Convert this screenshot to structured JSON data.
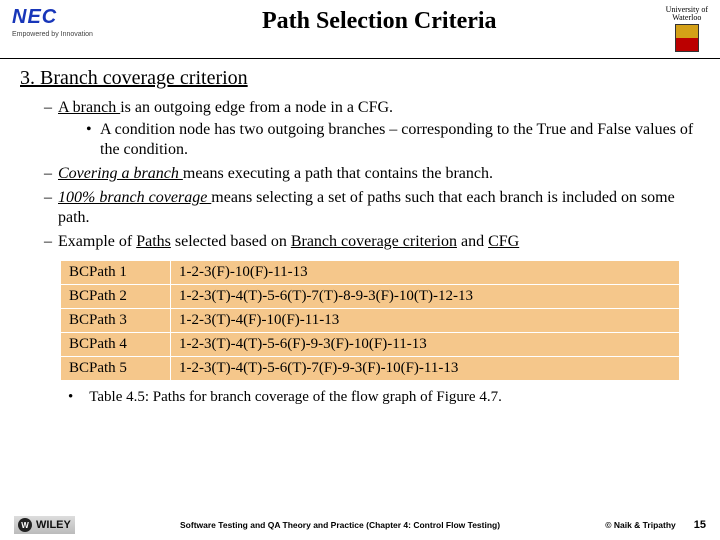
{
  "header": {
    "nec": "NEC",
    "nec_tag": "Empowered by Innovation",
    "title": "Path Selection Criteria",
    "uw_line1": "University of",
    "uw_line2": "Waterloo"
  },
  "section": {
    "heading": "3. Branch coverage criterion",
    "b1_pre": "A branch ",
    "b1_post": "is an outgoing edge from a node in a CFG.",
    "b1_sub": "A condition node has two outgoing branches – corresponding to the True and False values of the condition.",
    "b2_pre": "Covering a branch ",
    "b2_post": "means executing a path that contains the branch.",
    "b3_pre": "100% branch coverage ",
    "b3_post": "means selecting a set of paths such that each branch is included on some path.",
    "b4_a": "Example of ",
    "b4_b": "Paths",
    "b4_c": " selected based on ",
    "b4_d": "Branch coverage criterion",
    "b4_e": " and ",
    "b4_f": "CFG"
  },
  "table": {
    "rows": [
      {
        "name": "BCPath 1",
        "path": "1-2-3(F)-10(F)-11-13"
      },
      {
        "name": "BCPath 2",
        "path": "1-2-3(T)-4(T)-5-6(T)-7(T)-8-9-3(F)-10(T)-12-13"
      },
      {
        "name": "BCPath 3",
        "path": "1-2-3(T)-4(F)-10(F)-11-13"
      },
      {
        "name": "BCPath 4",
        "path": "1-2-3(T)-4(T)-5-6(F)-9-3(F)-10(F)-11-13"
      },
      {
        "name": "BCPath 5",
        "path": "1-2-3(T)-4(T)-5-6(T)-7(F)-9-3(F)-10(F)-11-13"
      }
    ],
    "caption": "Table 4.5: Paths for branch coverage of the flow graph of Figure 4.7."
  },
  "footer": {
    "wiley": "WILEY",
    "center": "Software Testing and QA Theory and Practice (Chapter 4: Control Flow Testing)",
    "right": "© Naik & Tripathy",
    "page": "15"
  }
}
